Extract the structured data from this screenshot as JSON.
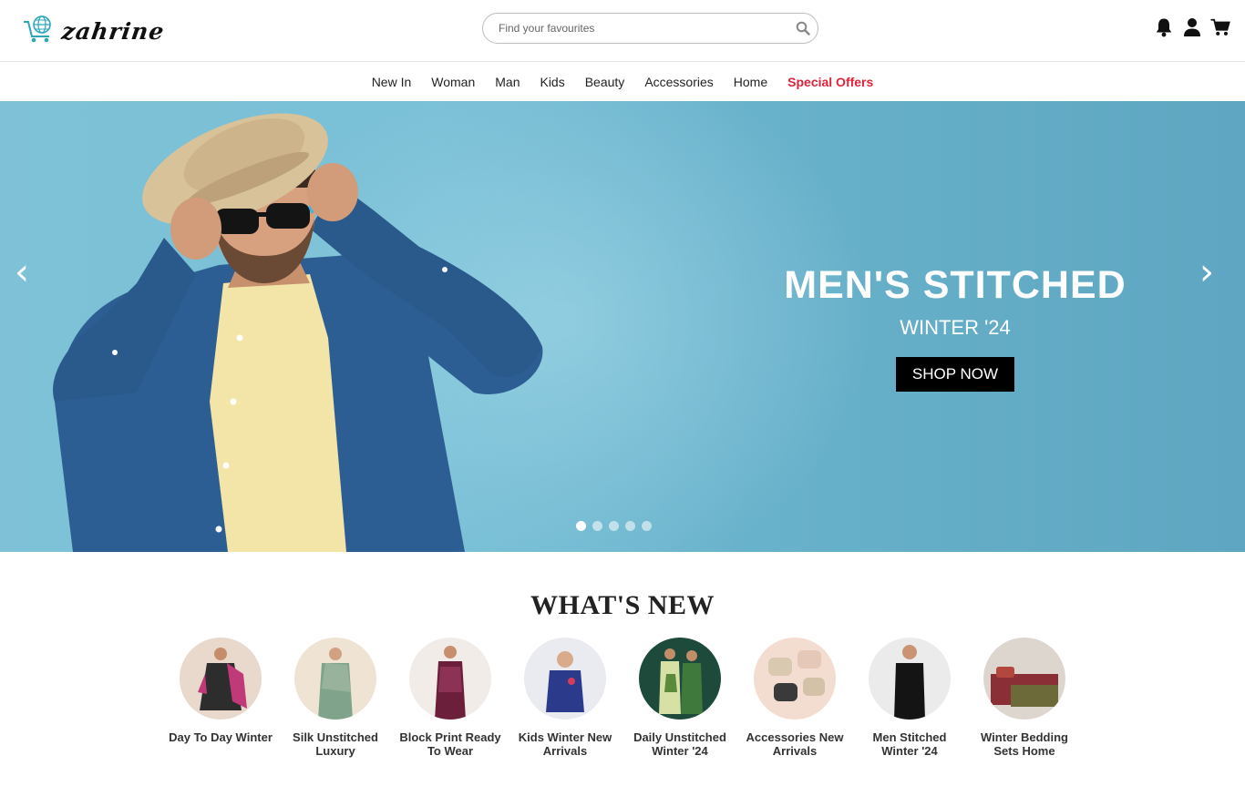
{
  "header": {
    "logo_text": "zahrine",
    "search_placeholder": "Find your favourites",
    "icons": [
      "bell-icon",
      "user-icon",
      "cart-icon"
    ]
  },
  "nav": {
    "items": [
      "New In",
      "Woman",
      "Man",
      "Kids",
      "Beauty",
      "Accessories",
      "Home"
    ],
    "special": "Special Offers"
  },
  "hero": {
    "title": "MEN'S STITCHED",
    "subtitle": "WINTER '24",
    "button": "SHOP NOW",
    "prev_arrow": "‹",
    "next_arrow": "›",
    "slide_count": 5,
    "active_slide": 1
  },
  "whats_new": {
    "title": "WHAT'S NEW",
    "categories": [
      {
        "label": "Day To Day Winter"
      },
      {
        "label": "Silk Unstitched Luxury"
      },
      {
        "label": "Block Print Ready To Wear"
      },
      {
        "label": "Kids Winter New Arrivals"
      },
      {
        "label": "Daily Unstitched Winter '24"
      },
      {
        "label": "Accessories New Arrivals"
      },
      {
        "label": "Men Stitched Winter '24"
      },
      {
        "label": "Winter Bedding Sets Home"
      }
    ]
  },
  "colors": {
    "accent_red": "#e0233a",
    "hero_bg": "#6fb7cf",
    "logo_teal": "#2aa7b8"
  }
}
